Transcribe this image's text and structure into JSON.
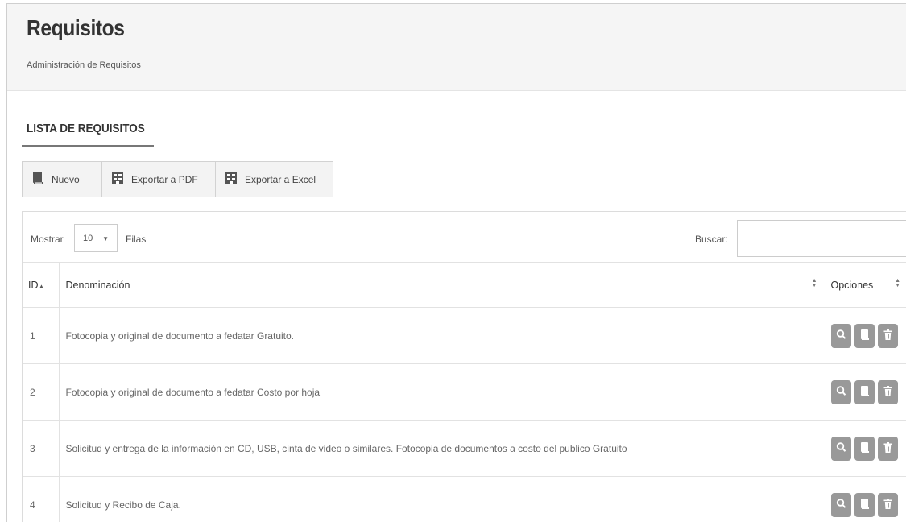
{
  "header": {
    "title": "Requisitos",
    "subtitle": "Administración de Requisitos"
  },
  "section": {
    "title": "LISTA DE REQUISITOS"
  },
  "toolbar": {
    "buttons": [
      {
        "label": "Nuevo",
        "icon": "book-icon"
      },
      {
        "label": "Exportar a PDF",
        "icon": "building-icon"
      },
      {
        "label": "Exportar a Excel",
        "icon": "building-icon"
      }
    ]
  },
  "controls": {
    "show_label": "Mostrar",
    "page_length": "10",
    "rows_label": "Filas",
    "search_label": "Buscar:",
    "search_value": ""
  },
  "table": {
    "columns": [
      "ID",
      "Denominación",
      "Opciones"
    ],
    "sort_indicator": "▲",
    "rows": [
      {
        "id": "1",
        "name": "Fotocopia y original de documento a fedatar Gratuito."
      },
      {
        "id": "2",
        "name": "Fotocopia y original de documento a fedatar Costo por hoja"
      },
      {
        "id": "3",
        "name": "Solicitud y entrega de la información en CD, USB, cinta de video o similares. Fotocopia de documentos a costo del publico Gratuito"
      },
      {
        "id": "4",
        "name": "Solicitud y Recibo de Caja."
      }
    ],
    "row_actions": [
      "search-icon",
      "book-icon",
      "trash-icon"
    ]
  },
  "colors": {
    "header_bg": "#f5f5f5",
    "button_bg": "#f3f3f3",
    "action_button": "#999999"
  }
}
